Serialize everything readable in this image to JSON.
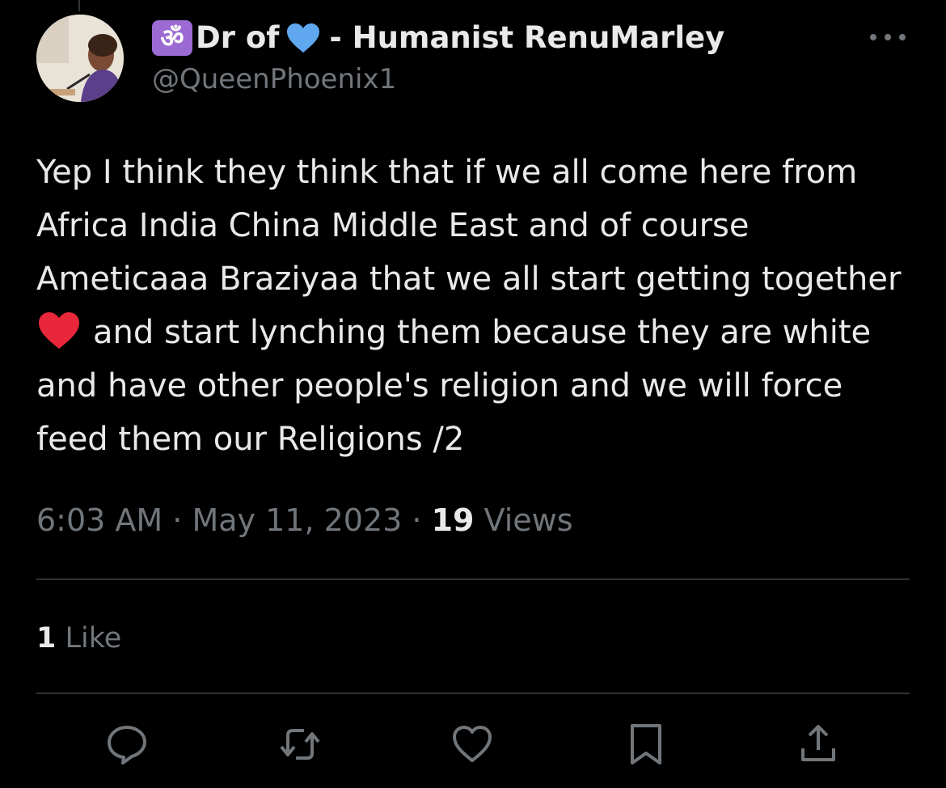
{
  "author": {
    "badge_glyph": "ॐ",
    "name_prefix": "Dr of",
    "name_suffix": "- Humanist RenuMarley",
    "handle": "@QueenPhoenix1"
  },
  "tweet": {
    "text_lines": [
      "Yep I think they think that if we all come here from",
      "Africa India China Middle East and of course",
      "Ameticaaa Braziyaa that we all start getting together",
      "and start lynching them because they are white",
      "and have other people's religion and we will force",
      "feed them our Religions  /2"
    ]
  },
  "meta": {
    "time": "6:03 AM",
    "separator": " · ",
    "date": "May 11, 2023",
    "views_count": "19",
    "views_label": "Views"
  },
  "engagement": {
    "likes_count": "1",
    "likes_label": "Like"
  },
  "actions": {
    "reply": "reply-icon",
    "retweet": "retweet-icon",
    "like": "heart-icon",
    "bookmark": "bookmark-icon",
    "share": "share-icon"
  },
  "colors": {
    "background": "#000000",
    "primary_text": "#e7e9ea",
    "secondary_text": "#71767b",
    "divider": "#2f3336",
    "badge_purple": "#9b6bd3",
    "blue_heart": "#5fa8f0",
    "red_heart": "#e8283a"
  }
}
